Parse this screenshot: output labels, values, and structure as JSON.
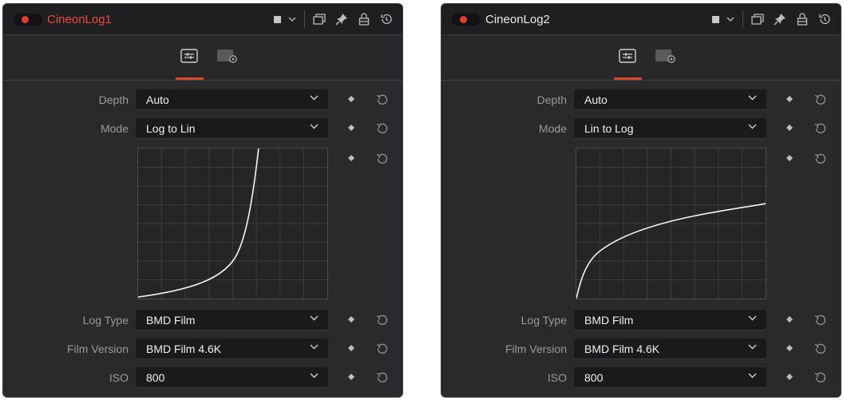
{
  "panels": [
    {
      "title": "CineonLog1",
      "title_color": "#ef4b3a",
      "depth": {
        "label": "Depth",
        "value": "Auto"
      },
      "mode": {
        "label": "Mode",
        "value": "Log to Lin"
      },
      "log_type": {
        "label": "Log Type",
        "value": "BMD Film"
      },
      "film_version": {
        "label": "Film Version",
        "value": "BMD Film 4.6K"
      },
      "iso": {
        "label": "ISO",
        "value": "800"
      },
      "curve": "log-to-lin"
    },
    {
      "title": "CineonLog2",
      "title_color": "#e8e8e8",
      "depth": {
        "label": "Depth",
        "value": "Auto"
      },
      "mode": {
        "label": "Mode",
        "value": "Lin to Log"
      },
      "log_type": {
        "label": "Log Type",
        "value": "BMD Film"
      },
      "film_version": {
        "label": "Film Version",
        "value": "BMD Film 4.6K"
      },
      "iso": {
        "label": "ISO",
        "value": "800"
      },
      "curve": "lin-to-log"
    }
  ],
  "icons": {
    "power": "power-toggle-icon",
    "color": "color-swatch-icon",
    "chevron": "chevron-down-icon",
    "window": "float-window-icon",
    "pin": "pin-icon",
    "lock": "lock-icon",
    "reset": "reset-icon",
    "keyframe": "keyframe-diamond-icon",
    "controls_tab": "controls-tab-icon",
    "settings_tab": "settings-tab-icon"
  },
  "accent_color": "#d9482f"
}
